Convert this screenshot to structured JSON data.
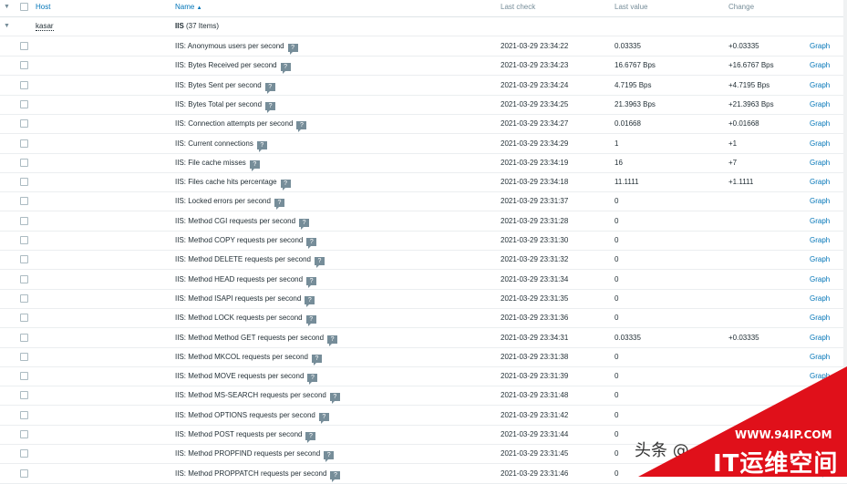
{
  "header": {
    "host": "Host",
    "name": "Name",
    "sort_arrow": "▲",
    "last_check": "Last check",
    "last_value": "Last value",
    "change": "Change"
  },
  "group": {
    "host": "kasar",
    "name": "IIS",
    "count": "(37 Items)"
  },
  "graph_label": "Graph",
  "help_glyph": "?",
  "rows": [
    {
      "name": "IIS: Anonymous users per second",
      "last_check": "2021-03-29 23:34:22",
      "last_value": "0.03335",
      "change": "+0.03335"
    },
    {
      "name": "IIS: Bytes Received per second",
      "last_check": "2021-03-29 23:34:23",
      "last_value": "16.6767 Bps",
      "change": "+16.6767 Bps"
    },
    {
      "name": "IIS: Bytes Sent per second",
      "last_check": "2021-03-29 23:34:24",
      "last_value": "4.7195 Bps",
      "change": "+4.7195 Bps"
    },
    {
      "name": "IIS: Bytes Total per second",
      "last_check": "2021-03-29 23:34:25",
      "last_value": "21.3963 Bps",
      "change": "+21.3963 Bps"
    },
    {
      "name": "IIS: Connection attempts per second",
      "last_check": "2021-03-29 23:34:27",
      "last_value": "0.01668",
      "change": "+0.01668"
    },
    {
      "name": "IIS: Current connections",
      "last_check": "2021-03-29 23:34:29",
      "last_value": "1",
      "change": "+1"
    },
    {
      "name": "IIS: File cache misses",
      "last_check": "2021-03-29 23:34:19",
      "last_value": "16",
      "change": "+7"
    },
    {
      "name": "IIS: Files cache hits percentage",
      "last_check": "2021-03-29 23:34:18",
      "last_value": "11.1111",
      "change": "+1.1111"
    },
    {
      "name": "IIS: Locked errors per second",
      "last_check": "2021-03-29 23:31:37",
      "last_value": "0",
      "change": ""
    },
    {
      "name": "IIS: Method CGI requests per second",
      "last_check": "2021-03-29 23:31:28",
      "last_value": "0",
      "change": ""
    },
    {
      "name": "IIS: Method COPY requests per second",
      "last_check": "2021-03-29 23:31:30",
      "last_value": "0",
      "change": ""
    },
    {
      "name": "IIS: Method DELETE requests per second",
      "last_check": "2021-03-29 23:31:32",
      "last_value": "0",
      "change": ""
    },
    {
      "name": "IIS: Method HEAD requests per second",
      "last_check": "2021-03-29 23:31:34",
      "last_value": "0",
      "change": ""
    },
    {
      "name": "IIS: Method ISAPI requests per second",
      "last_check": "2021-03-29 23:31:35",
      "last_value": "0",
      "change": ""
    },
    {
      "name": "IIS: Method LOCK requests per second",
      "last_check": "2021-03-29 23:31:36",
      "last_value": "0",
      "change": ""
    },
    {
      "name": "IIS: Method Method GET requests per second",
      "last_check": "2021-03-29 23:34:31",
      "last_value": "0.03335",
      "change": "+0.03335"
    },
    {
      "name": "IIS: Method MKCOL requests per second",
      "last_check": "2021-03-29 23:31:38",
      "last_value": "0",
      "change": ""
    },
    {
      "name": "IIS: Method MOVE requests per second",
      "last_check": "2021-03-29 23:31:39",
      "last_value": "0",
      "change": ""
    },
    {
      "name": "IIS: Method MS-SEARCH requests per second",
      "last_check": "2021-03-29 23:31:48",
      "last_value": "0",
      "change": ""
    },
    {
      "name": "IIS: Method OPTIONS requests per second",
      "last_check": "2021-03-29 23:31:42",
      "last_value": "0",
      "change": ""
    },
    {
      "name": "IIS: Method POST requests per second",
      "last_check": "2021-03-29 23:31:44",
      "last_value": "0",
      "change": ""
    },
    {
      "name": "IIS: Method PROPFIND requests per second",
      "last_check": "2021-03-29 23:31:45",
      "last_value": "0",
      "change": ""
    },
    {
      "name": "IIS: Method PROPPATCH requests per second",
      "last_check": "2021-03-29 23:31:46",
      "last_value": "0",
      "change": ""
    }
  ],
  "watermark": {
    "text": "头条 @",
    "url": "WWW.94IP.COM",
    "title": "IT运维空间"
  },
  "colors": {
    "link": "#0275b8",
    "muted": "#768d99",
    "ribbon": "#e0101a"
  }
}
